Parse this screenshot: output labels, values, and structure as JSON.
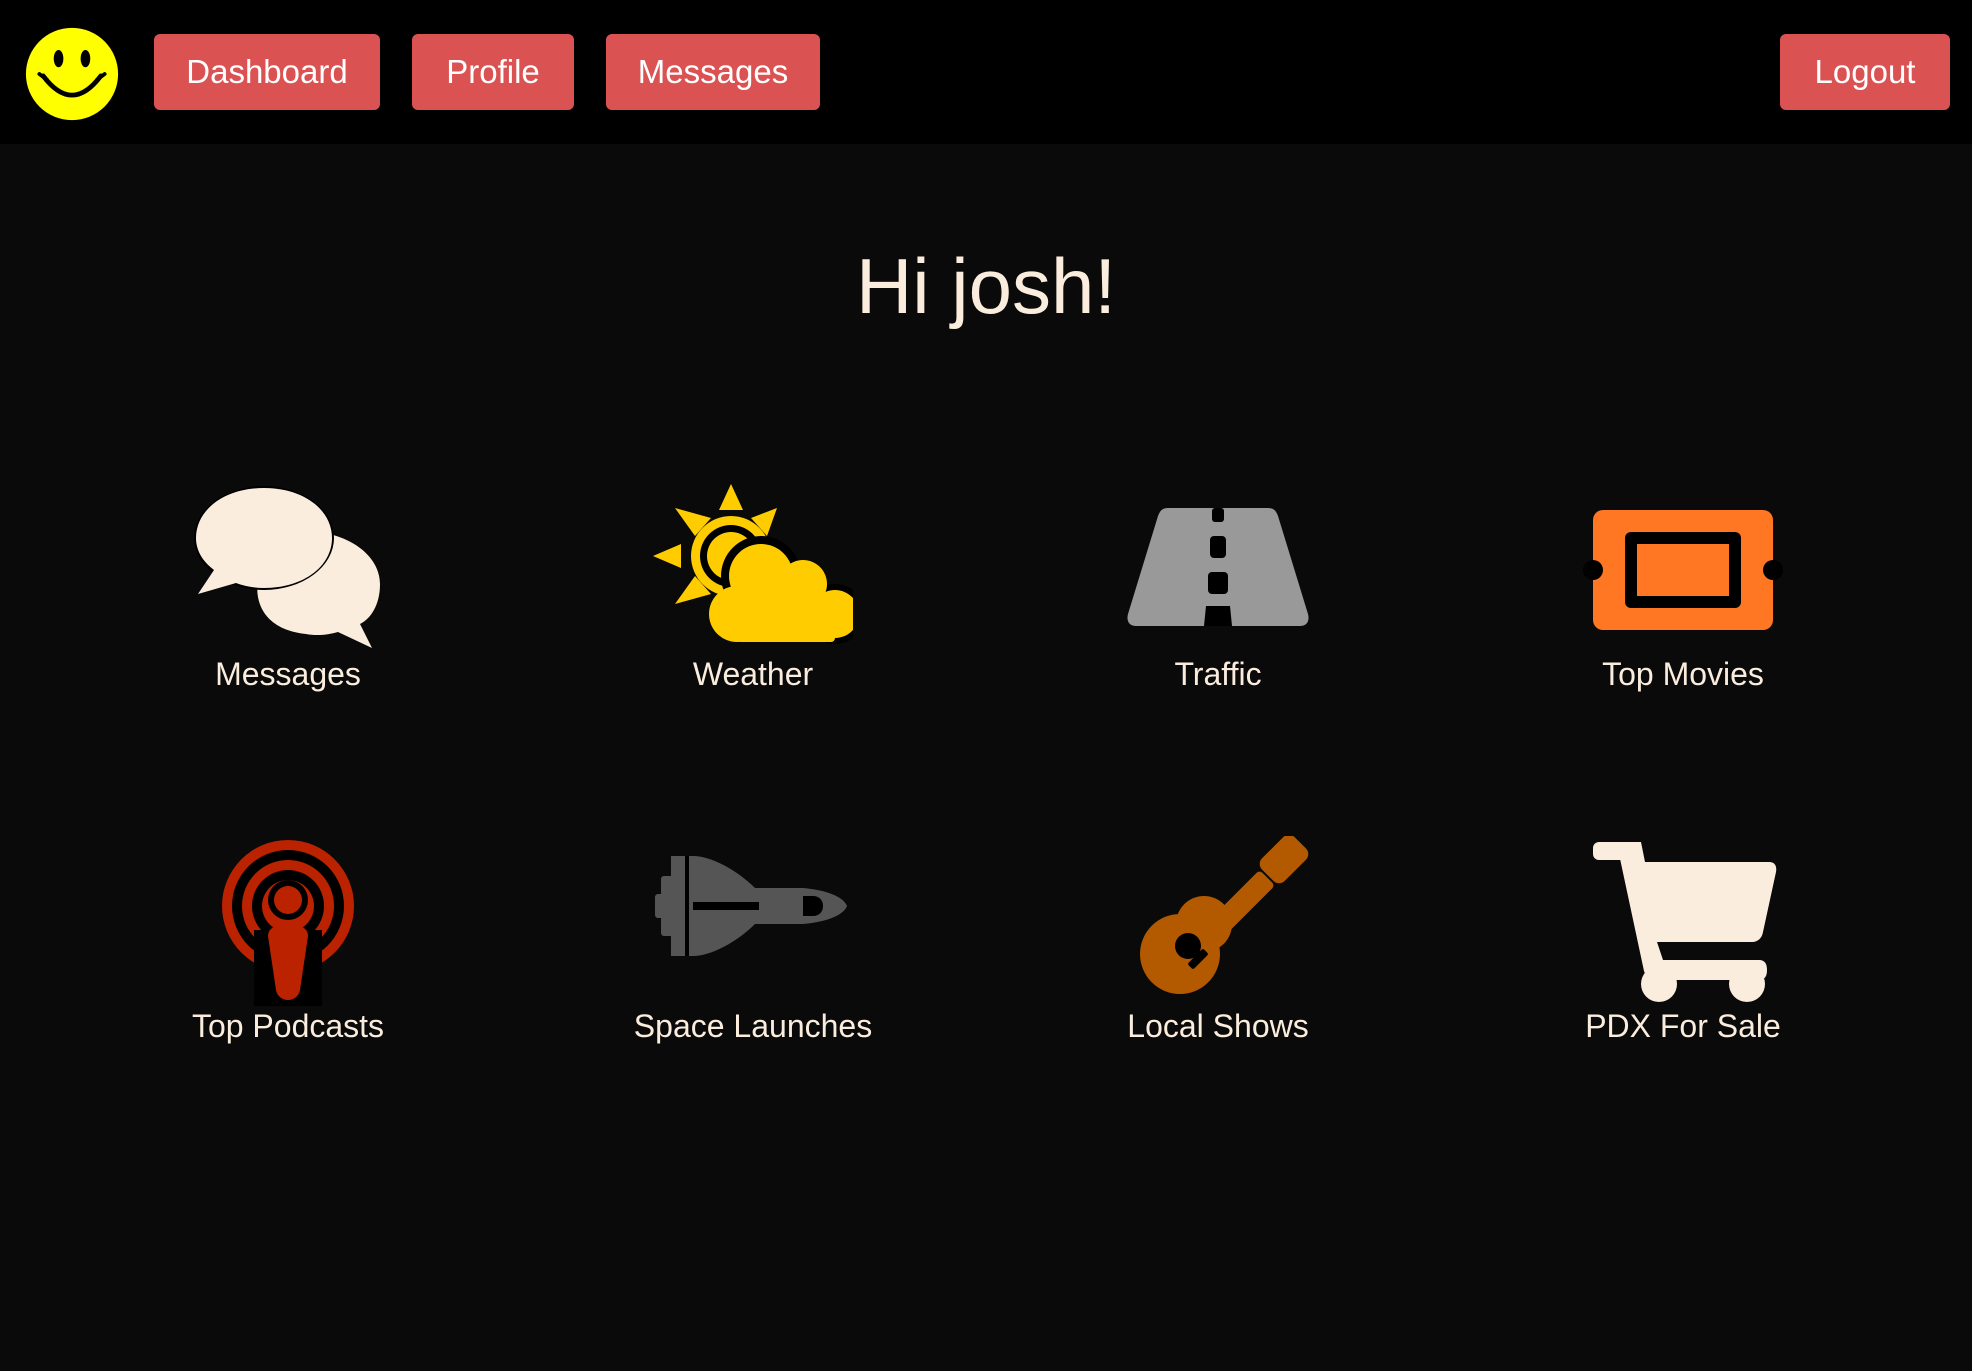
{
  "nav": {
    "logo_icon": "smiley-face-icon",
    "dashboard_label": "Dashboard",
    "profile_label": "Profile",
    "messages_label": "Messages",
    "logout_label": "Logout",
    "button_color": "#db5252"
  },
  "greeting": "Hi josh!",
  "tiles": [
    {
      "label": "Messages",
      "icon": "chat-bubbles-icon",
      "color": "#faeddd"
    },
    {
      "label": "Weather",
      "icon": "sun-cloud-icon",
      "color": "#ffcc00"
    },
    {
      "label": "Traffic",
      "icon": "road-icon",
      "color": "#999999"
    },
    {
      "label": "Top Movies",
      "icon": "ticket-icon",
      "color": "#ff7722"
    },
    {
      "label": "Top Podcasts",
      "icon": "podcast-icon",
      "color": "#bb2200"
    },
    {
      "label": "Space Launches",
      "icon": "space-shuttle-icon",
      "color": "#555555"
    },
    {
      "label": "Local Shows",
      "icon": "guitar-icon",
      "color": "#b35900"
    },
    {
      "label": "PDX For Sale",
      "icon": "shopping-cart-icon",
      "color": "#faeddd"
    }
  ]
}
